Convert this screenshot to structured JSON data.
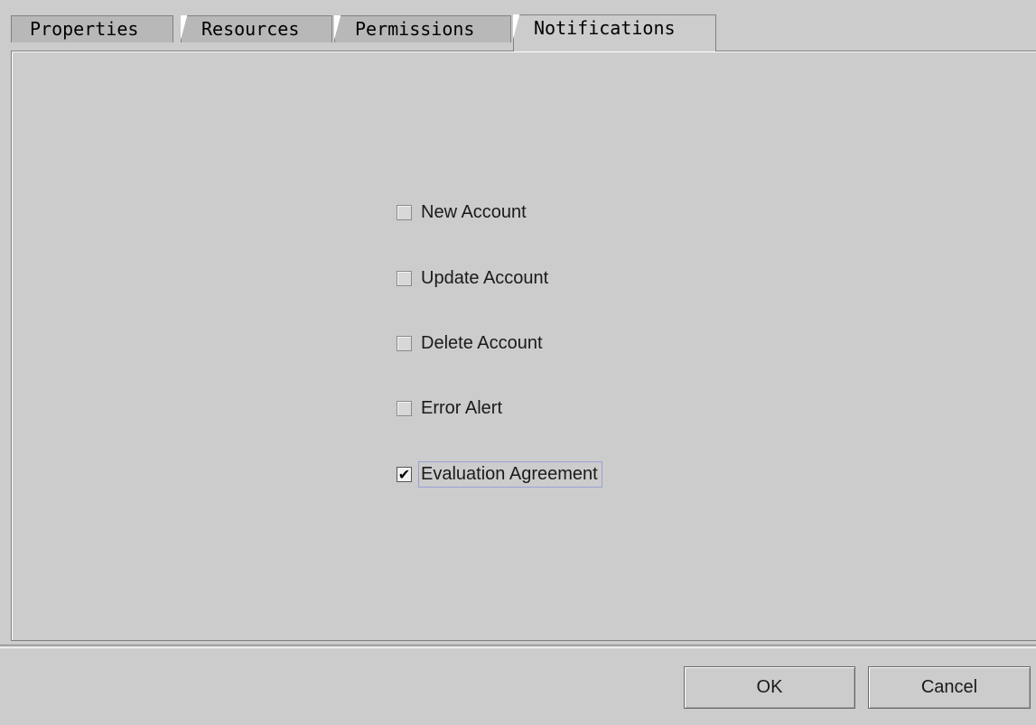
{
  "tabs": [
    {
      "label": "Properties",
      "active": false
    },
    {
      "label": "Resources",
      "active": false
    },
    {
      "label": "Permissions",
      "active": false
    },
    {
      "label": "Notifications",
      "active": true
    }
  ],
  "notifications": [
    {
      "label": "New Account",
      "checked": false
    },
    {
      "label": "Update Account",
      "checked": false
    },
    {
      "label": "Delete Account",
      "checked": false
    },
    {
      "label": "Error Alert",
      "checked": false
    },
    {
      "label": "Evaluation Agreement",
      "checked": true,
      "focused": true
    }
  ],
  "check_glyph": "✔",
  "buttons": {
    "ok_label": "OK",
    "cancel_label": "Cancel"
  }
}
